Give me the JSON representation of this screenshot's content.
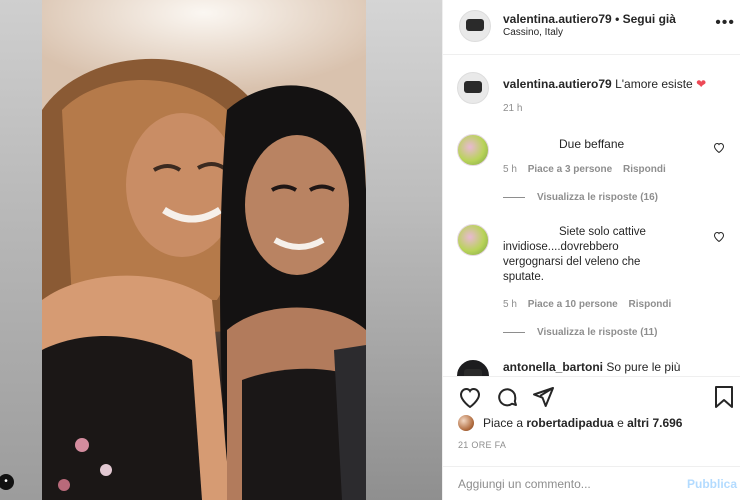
{
  "post": {
    "author": "valentina.autiero79",
    "follow_label": "• Segui già",
    "location": "Cassino, Italy",
    "more_label": "•••"
  },
  "caption": {
    "author": "valentina.autiero79",
    "text": "L'amore esiste",
    "emoji": "❤",
    "time": "21 h"
  },
  "comments": [
    {
      "text": "Due beffane",
      "time": "5 h",
      "likes": "Piace a 3 persone",
      "reply": "Rispondi",
      "view_replies": "Visualizza le risposte (16)"
    },
    {
      "text_lines": [
        "Siete solo cattive",
        "invidiose....dovrebbero",
        "vergognarsi del veleno che",
        "sputate."
      ],
      "time": "5 h",
      "likes": "Piace a 10 persone",
      "reply": "Rispondi",
      "view_replies": "Visualizza le risposte (11)"
    },
    {
      "author": "antonella_bartoni",
      "text": "So pure le più"
    }
  ],
  "likes": {
    "prefix": "Piace a",
    "user": "robertadipadua",
    "middle": "e",
    "others": "altri 7.696"
  },
  "timestamp": "21 ORE FA",
  "comment_input": {
    "placeholder": "Aggiungi un commento...",
    "publish": "Pubblica"
  },
  "icons": {
    "like": "heart-icon",
    "comment": "comment-icon",
    "share": "paper-plane-icon",
    "save": "bookmark-icon",
    "emoji": "smiley-icon",
    "more": "more-horizontal-icon"
  },
  "colors": {
    "text": "#262626",
    "muted": "#8e8e8e",
    "link_disabled": "#b3dbff",
    "heart_red": "#ed4956"
  }
}
